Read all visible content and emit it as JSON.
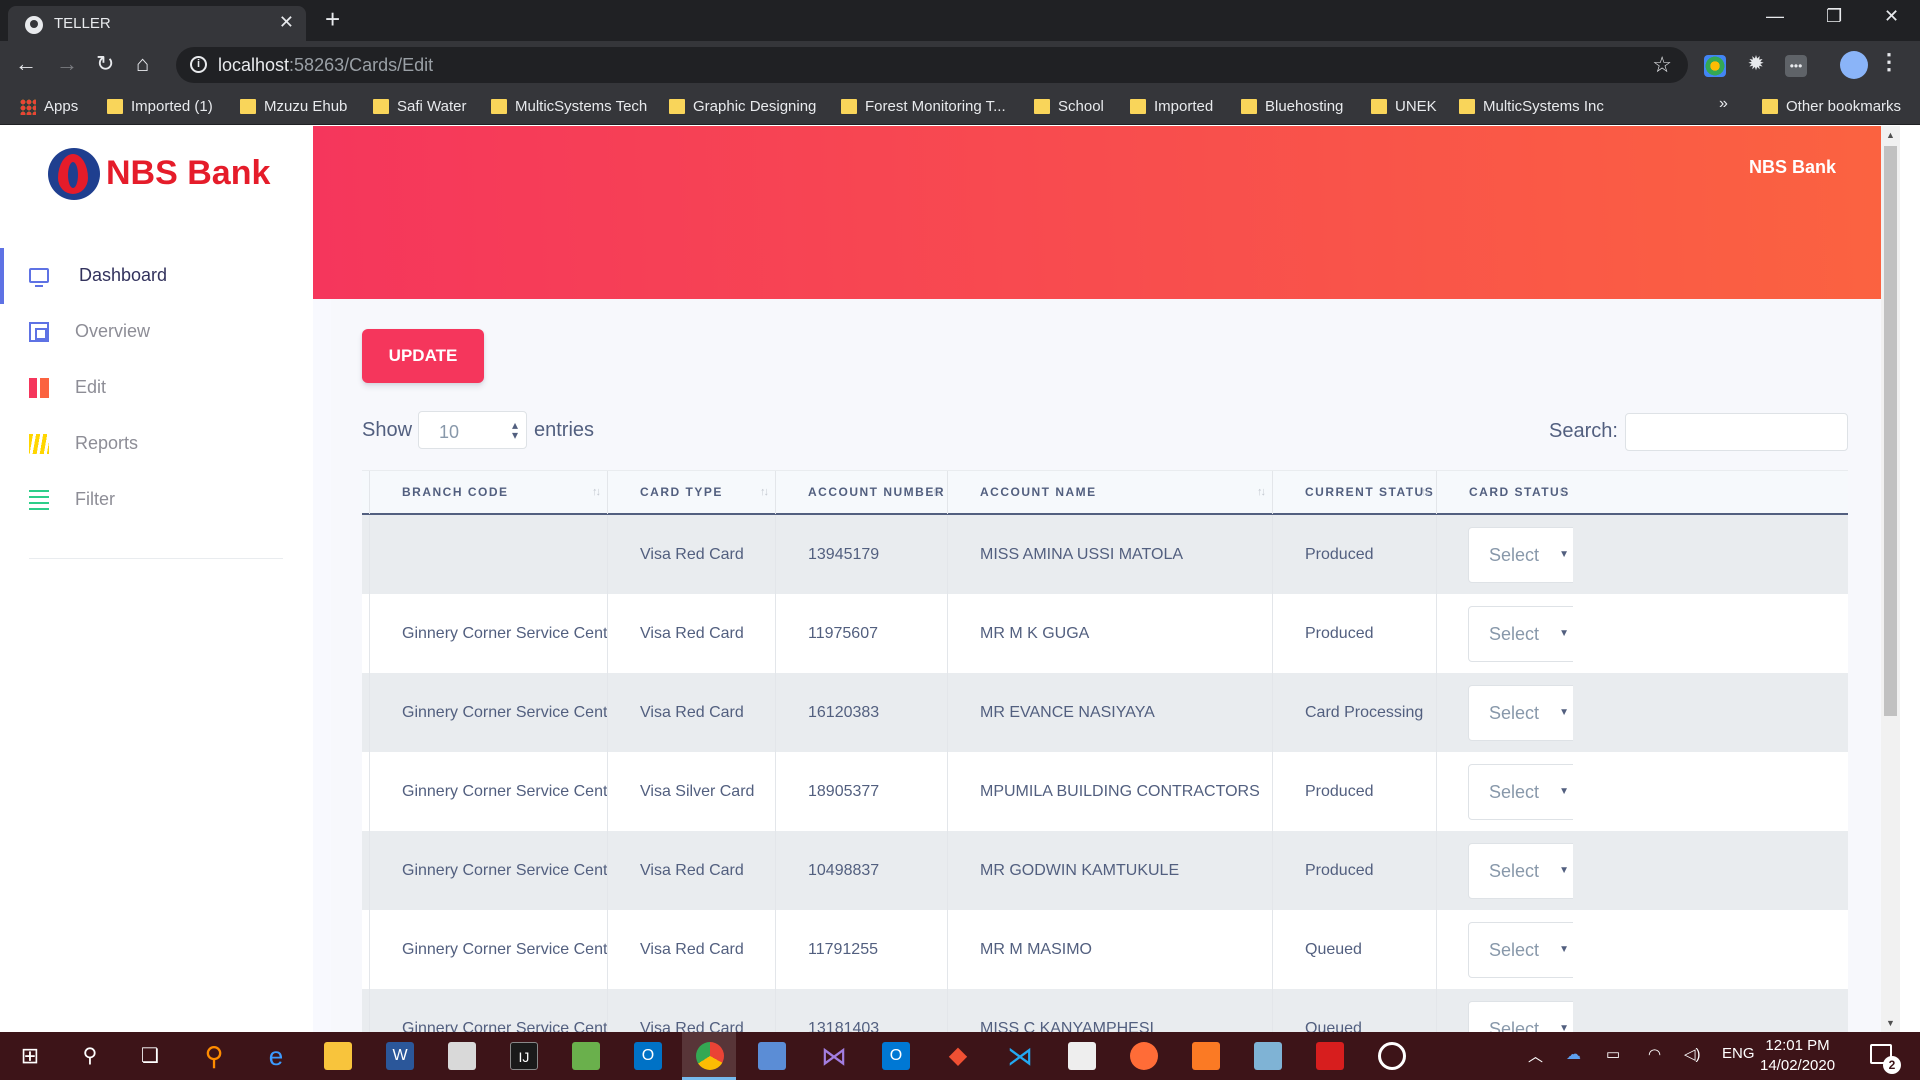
{
  "browser": {
    "tab_title": "TELLER",
    "url_host": "localhost",
    "url_rest": ":58263/Cards/Edit",
    "bookmarks": [
      {
        "label": "Apps",
        "type": "apps"
      },
      {
        "label": "Imported (1)",
        "type": "folder"
      },
      {
        "label": "Mzuzu Ehub",
        "type": "folder"
      },
      {
        "label": "Safi Water",
        "type": "folder"
      },
      {
        "label": "MulticSystems Tech",
        "type": "folder"
      },
      {
        "label": "Graphic Designing",
        "type": "folder"
      },
      {
        "label": "Forest Monitoring T...",
        "type": "folder"
      },
      {
        "label": "School",
        "type": "folder"
      },
      {
        "label": "Imported",
        "type": "folder"
      },
      {
        "label": "Bluehosting",
        "type": "folder"
      },
      {
        "label": "UNEK",
        "type": "folder"
      },
      {
        "label": "MulticSystems Inc",
        "type": "folder"
      }
    ],
    "overflow_chevron": "»",
    "other_bookmarks": "Other bookmarks"
  },
  "app": {
    "logo_text": "NBS Bank",
    "header_brand": "NBS Bank",
    "nav": [
      {
        "label": "Dashboard",
        "icon": "monitor-icon",
        "active": true
      },
      {
        "label": "Overview",
        "icon": "planet-icon",
        "active": false
      },
      {
        "label": "Edit",
        "icon": "edit-icon",
        "active": false
      },
      {
        "label": "Reports",
        "icon": "reports-icon",
        "active": false
      },
      {
        "label": "Filter",
        "icon": "filter-icon",
        "active": false
      }
    ],
    "colors": {
      "primary": "#5e72e4",
      "danger": "#f5365c",
      "orange": "#fb6340",
      "brand_red": "#e51c2a"
    }
  },
  "page": {
    "update_label": "UPDATE",
    "show_label": "Show",
    "entries_value": "10",
    "entries_label": "entries",
    "search_label": "Search:",
    "search_value": ""
  },
  "table": {
    "columns": [
      "BRANCH CODE",
      "CARD TYPE",
      "ACCOUNT NUMBER",
      "ACCOUNT NAME",
      "CURRENT STATUS",
      "CARD STATUS"
    ],
    "select_label": "Select",
    "rows": [
      {
        "branch": "",
        "card_type": "Visa Red Card",
        "account_number": "13945179",
        "account_name": "MISS AMINA USSI MATOLA",
        "status": "Produced"
      },
      {
        "branch": "Ginnery Corner Service Centre",
        "card_type": "Visa Red Card",
        "account_number": "11975607",
        "account_name": "MR M K GUGA",
        "status": "Produced"
      },
      {
        "branch": "Ginnery Corner Service Centre",
        "card_type": "Visa Red Card",
        "account_number": "16120383",
        "account_name": "MR EVANCE NASIYAYA",
        "status": "Card Processing"
      },
      {
        "branch": "Ginnery Corner Service Centre",
        "card_type": "Visa Silver Card",
        "account_number": "18905377",
        "account_name": "MPUMILA BUILDING CONTRACTORS",
        "status": "Produced"
      },
      {
        "branch": "Ginnery Corner Service Centre",
        "card_type": "Visa Red Card",
        "account_number": "10498837",
        "account_name": "MR GODWIN KAMTUKULE",
        "status": "Produced"
      },
      {
        "branch": "Ginnery Corner Service Centre",
        "card_type": "Visa Red Card",
        "account_number": "11791255",
        "account_name": "MR M MASIMO",
        "status": "Queued"
      },
      {
        "branch": "Ginnery Corner Service Centre",
        "card_type": "Visa Red Card",
        "account_number": "13181403",
        "account_name": "MISS C KANYAMPHESI",
        "status": "Queued"
      }
    ]
  },
  "taskbar": {
    "language": "ENG",
    "time": "12:01 PM",
    "date": "14/02/2020",
    "notification_count": "2"
  }
}
